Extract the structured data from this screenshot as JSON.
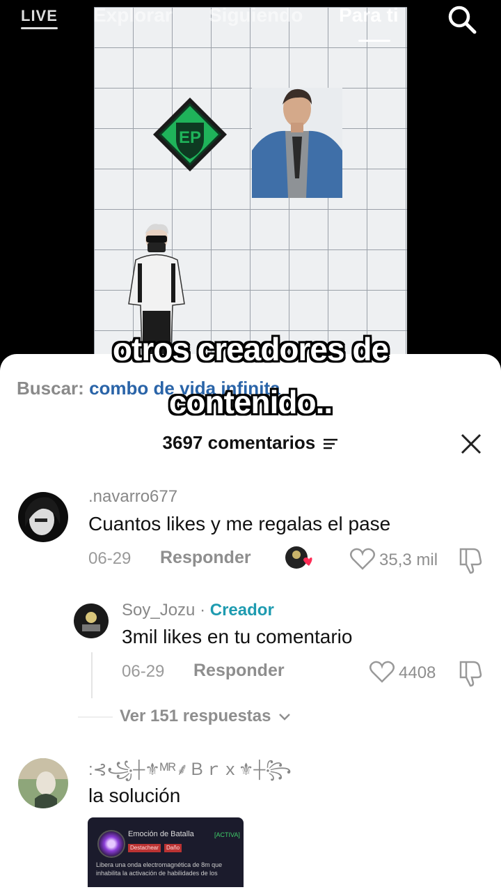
{
  "top_nav": {
    "live_label": "LIVE",
    "tabs": [
      {
        "label": "Explorar",
        "active": false
      },
      {
        "label": "Siguiendo",
        "active": false
      },
      {
        "label": "Para ti",
        "active": true
      }
    ]
  },
  "video": {
    "logo_text": "EP",
    "caption_line1": "otros creadores de",
    "caption_line2": "contenido.."
  },
  "comments_sheet": {
    "search_label": "Buscar:",
    "search_query": "combo de vida infinita",
    "comment_count": "3697 comentarios",
    "comments": [
      {
        "username": ".navarro677",
        "text": "Cuantos likes y me regalas el pase",
        "date": "06-29",
        "reply_label": "Responder",
        "likes": "35,3 mil"
      },
      {
        "username": "Soy_Jozu",
        "separator": "·",
        "badge": "Creador",
        "text": "3mil likes en tu comentario",
        "date": "06-29",
        "reply_label": "Responder",
        "likes": "4408"
      },
      {
        "username": ":⊰꧁┼⚜ᴹᴿ⸙Ｂｒｘ⚜┼꧂",
        "text": "la solución"
      }
    ],
    "view_replies": "Ver 151 respuestas",
    "attached_image": {
      "title": "Emoción de Batalla",
      "status": "[ACTIVA]",
      "tag1": "Destachear",
      "tag2": "Daño",
      "description": "Libera una onda electromagnética de 8m que inhabilita la activación de habilidades de los"
    }
  }
}
